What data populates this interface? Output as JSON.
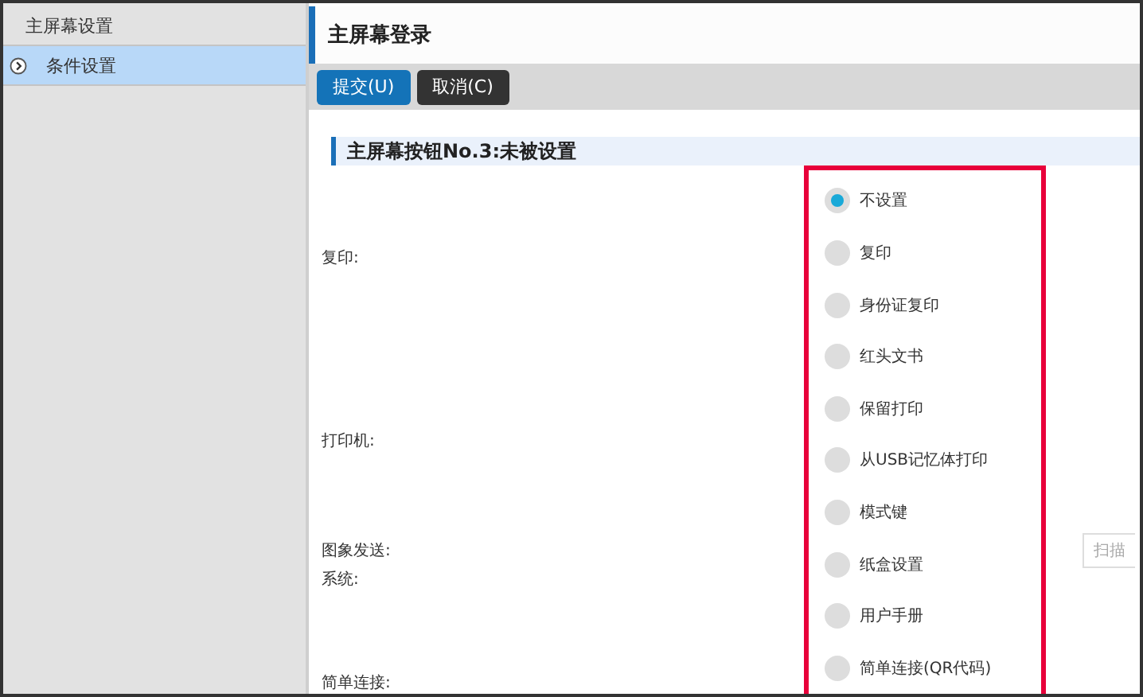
{
  "sidebar": {
    "items": [
      {
        "label": "主屏幕设置",
        "selected": false,
        "has_arrow": false
      },
      {
        "label": "条件设置",
        "selected": true,
        "has_arrow": true
      }
    ]
  },
  "page": {
    "title": "主屏幕登录"
  },
  "toolbar": {
    "buttons": [
      {
        "label": "提交(U)",
        "kind": "primary"
      },
      {
        "label": "取消(C)",
        "kind": "dark"
      }
    ]
  },
  "section": {
    "heading": "主屏幕按钮No.3:未被设置"
  },
  "options": [
    {
      "label": "不设置",
      "selected": true
    },
    {
      "label": "复印",
      "selected": false,
      "category": "复印:"
    },
    {
      "label": "身份证复印",
      "selected": false
    },
    {
      "label": "红头文书",
      "selected": false
    },
    {
      "label": "保留打印",
      "selected": false,
      "category": "打印机:"
    },
    {
      "label": "从USB记忆体打印",
      "selected": false
    },
    {
      "label": "模式键",
      "selected": false,
      "category": "图象发送:",
      "side_button": "扫描"
    },
    {
      "label": "纸盒设置",
      "selected": false,
      "category": "系统:"
    },
    {
      "label": "用户手册",
      "selected": false
    },
    {
      "label": "简单连接(QR代码)",
      "selected": false,
      "category": "简单连接:"
    }
  ]
}
